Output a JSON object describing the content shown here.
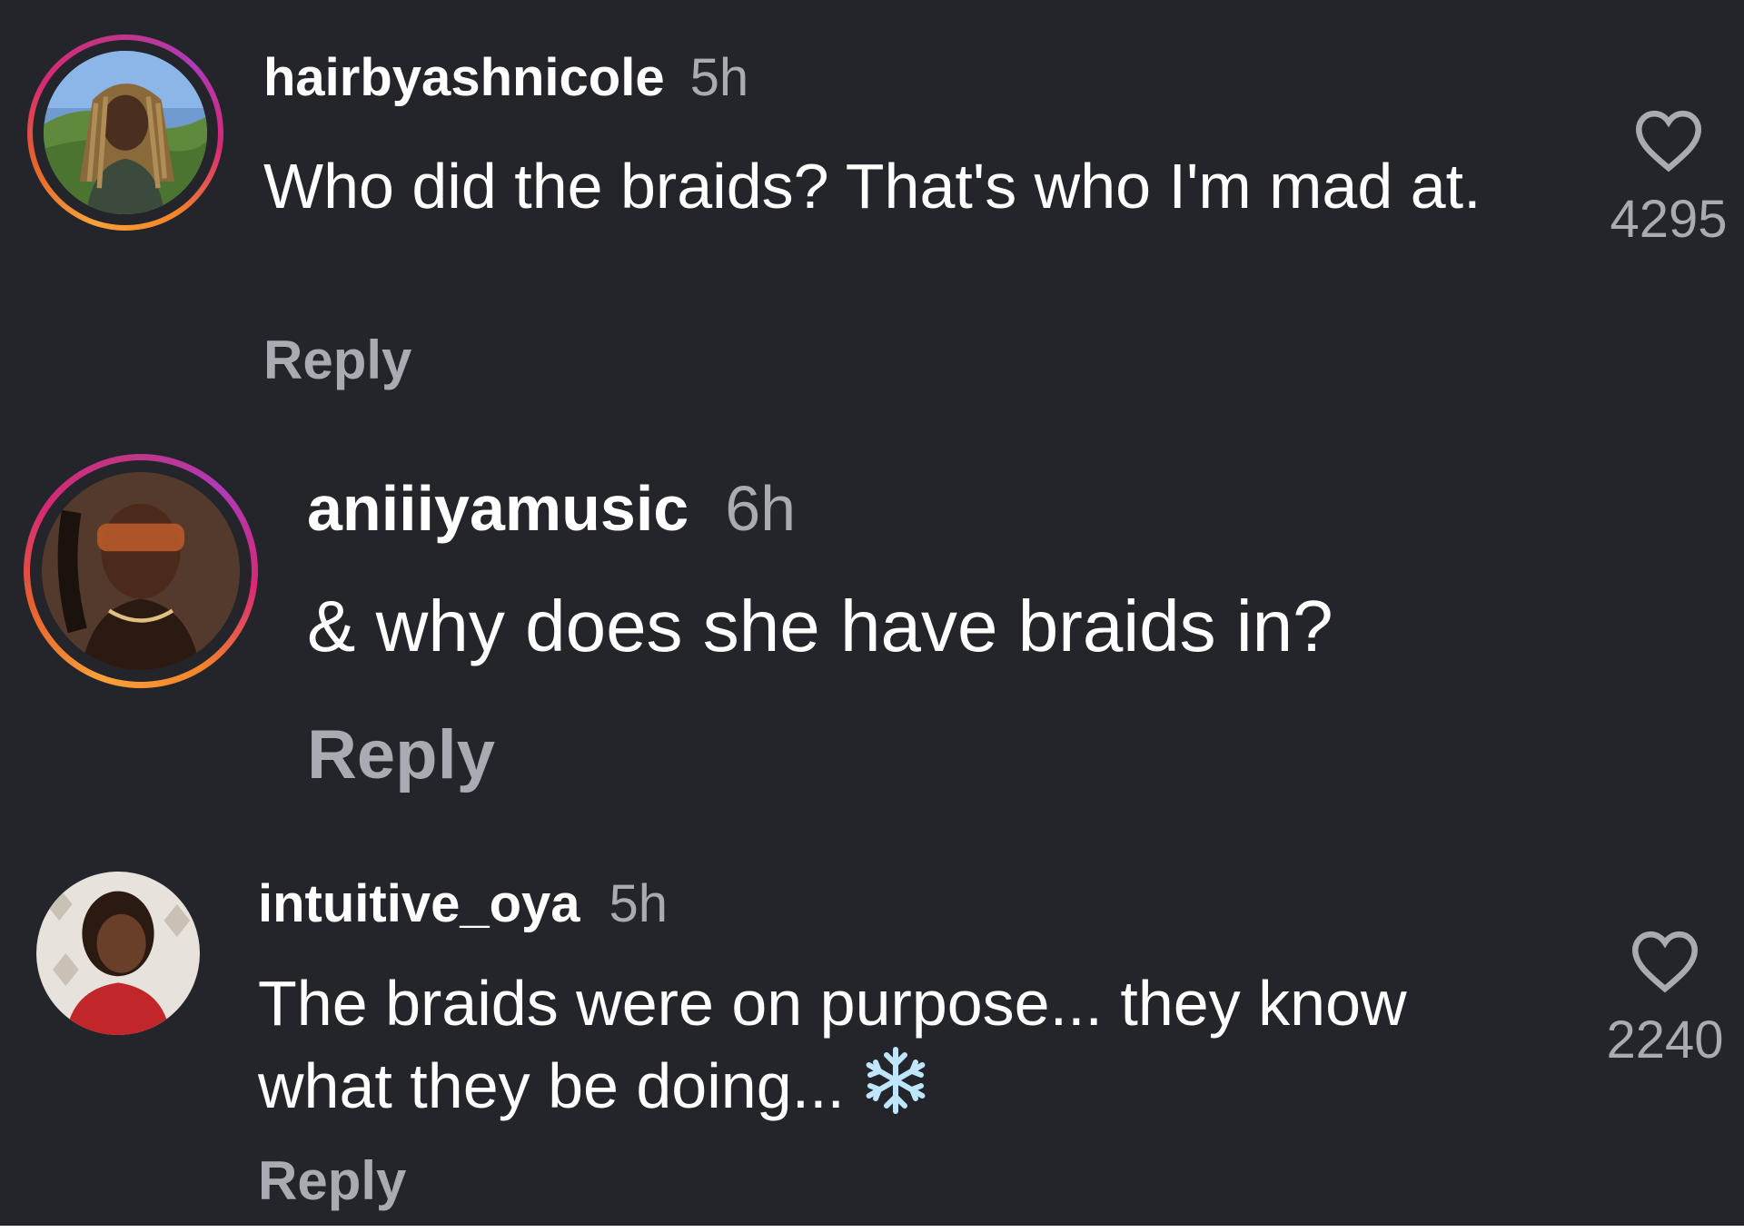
{
  "comments": [
    {
      "username": "hairbyashnicole",
      "time": "5h",
      "text": "Who did the braids? That's who I'm mad at.",
      "reply_label": "Reply",
      "like_count": "4295",
      "avatar_story_ring": true
    },
    {
      "username": "aniiiyamusic",
      "time": "6h",
      "text": "& why does she have braids in?",
      "reply_label": "Reply",
      "avatar_story_ring": true
    },
    {
      "username": "intuitive_oya",
      "time": "5h",
      "text": "The braids were on purpose... they know what they be doing...",
      "reply_label": "Reply",
      "like_count": "2240",
      "avatar_story_ring": false,
      "trailing_emoji": "snowflake-icon"
    }
  ],
  "colors": {
    "background": "#23252b",
    "primary_text": "#ffffff",
    "secondary_text": "#a9abb2",
    "story_ring_gradient": [
      "#f9a03a",
      "#d62976",
      "#b03ab8"
    ],
    "snowflake": "#bfe6ff"
  }
}
